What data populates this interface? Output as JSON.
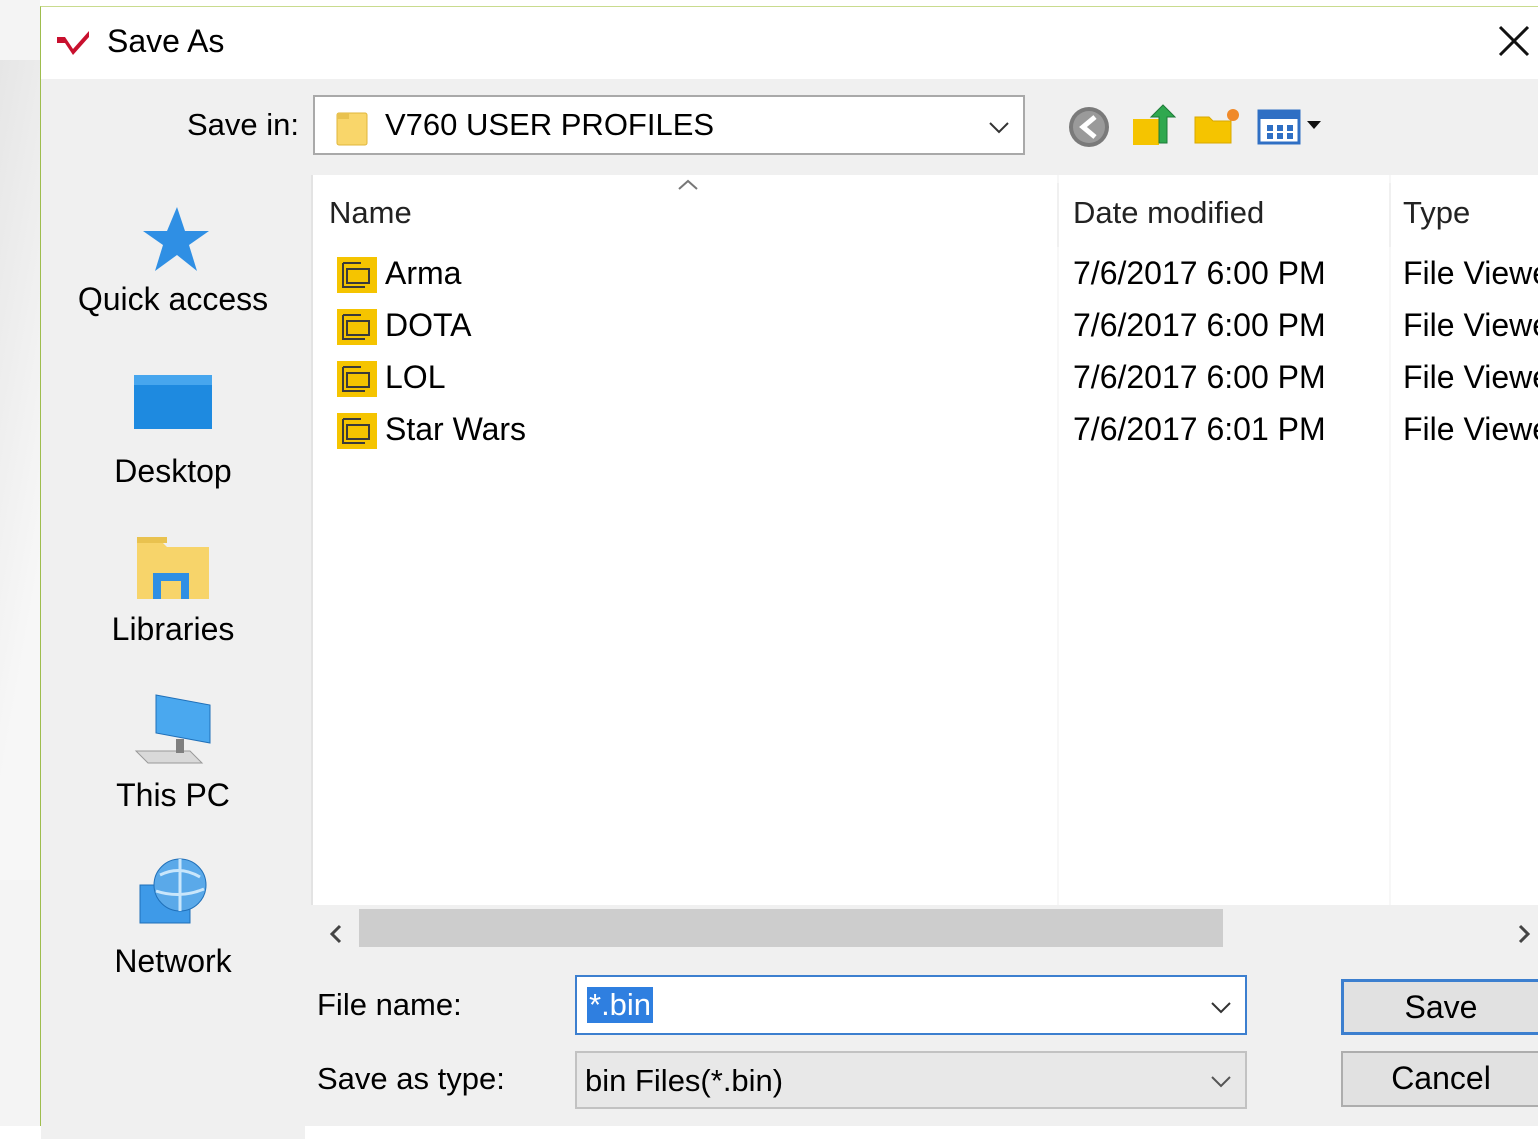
{
  "dialog": {
    "title": "Save As",
    "close_icon": "close-icon"
  },
  "save_in": {
    "label": "Save in:",
    "value": "V760 USER PROFILES"
  },
  "toolbar": {
    "icons": [
      "back-icon",
      "up-folder-icon",
      "new-folder-icon",
      "view-menu-icon"
    ]
  },
  "places": [
    {
      "label": "Quick access",
      "icon": "star-icon"
    },
    {
      "label": "Desktop",
      "icon": "desktop-icon"
    },
    {
      "label": "Libraries",
      "icon": "libraries-icon"
    },
    {
      "label": "This PC",
      "icon": "computer-icon"
    },
    {
      "label": "Network",
      "icon": "network-icon"
    }
  ],
  "columns": {
    "name": "Name",
    "date": "Date modified",
    "type": "Type"
  },
  "files": [
    {
      "name": "Arma",
      "date": "7/6/2017 6:00 PM",
      "type": "File Viewe"
    },
    {
      "name": "DOTA",
      "date": "7/6/2017 6:00 PM",
      "type": "File Viewe"
    },
    {
      "name": "LOL",
      "date": "7/6/2017 6:00 PM",
      "type": "File Viewe"
    },
    {
      "name": "Star Wars",
      "date": "7/6/2017 6:01 PM",
      "type": "File Viewe"
    }
  ],
  "file_name": {
    "label": "File name:",
    "value": "*.bin"
  },
  "save_as_type": {
    "label": "Save as type:",
    "value": "bin Files(*.bin)"
  },
  "buttons": {
    "save": "Save",
    "cancel": "Cancel"
  },
  "colors": {
    "accent": "#3c7fcf",
    "selection": "#2f7fe0",
    "folder": "#f5c400"
  }
}
